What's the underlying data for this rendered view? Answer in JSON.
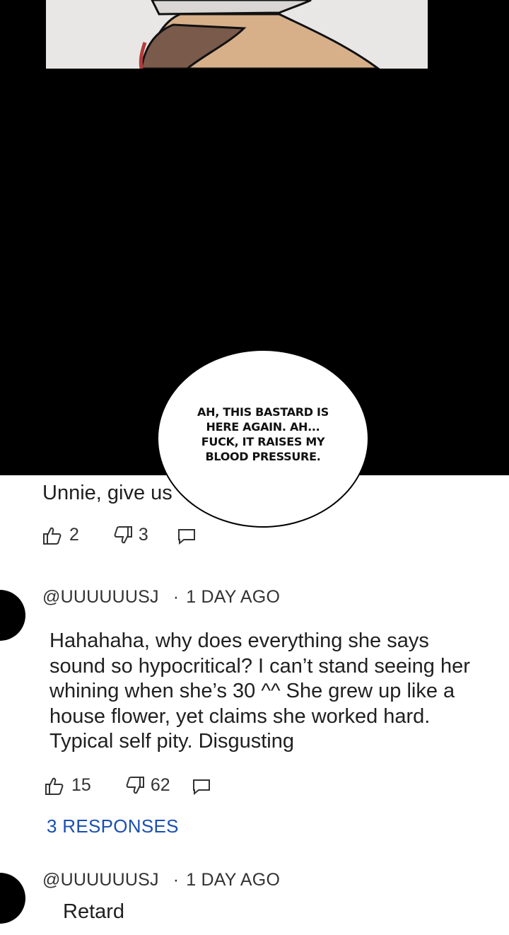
{
  "bubble": {
    "text": "AH, THIS BASTARD IS HERE AGAIN. AH... FUCK, IT RAISES MY BLOOD PRESSURE."
  },
  "comments": [
    {
      "text": "Unnie, give us",
      "likes": "2",
      "dislikes": "3"
    },
    {
      "user": "@UUUUUUSJ",
      "time": "1 DAY AGO",
      "text": "Hahahaha, why does everything she says sound so hypocritical? I can’t stand seeing her whining when she’s 30 ^^ She grew up like a house flower, yet claims she worked hard. Typical self pity. Disgusting",
      "likes": "15",
      "dislikes": "62",
      "responses": "3 RESPONSES"
    },
    {
      "user": "@UUUUUUSJ",
      "time": "1 DAY AGO",
      "text": "Retard"
    }
  ],
  "icons": {
    "like": "thumbs-up-icon",
    "dislike": "thumbs-down-icon",
    "reply": "reply-icon"
  },
  "colors": {
    "link": "#1a4fb0",
    "panel": "#000000"
  }
}
